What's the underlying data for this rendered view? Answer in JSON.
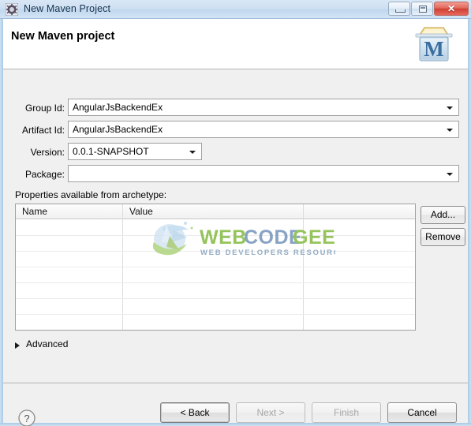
{
  "window": {
    "title": "New Maven Project",
    "icon": "maven-gear-icon",
    "controls": {
      "minimize": "minimize",
      "maximize": "maximize",
      "close": "✕"
    }
  },
  "header": {
    "title": "New Maven project",
    "logo_letter": "M",
    "logo_alt": "maven-box-icon"
  },
  "form": {
    "fields": [
      {
        "label": "Group Id:",
        "value": "AngularJsBackendEx",
        "type": "combo",
        "name": "group-id"
      },
      {
        "label": "Artifact Id:",
        "value": "AngularJsBackendEx",
        "type": "combo",
        "name": "artifact-id"
      },
      {
        "label": "Version:",
        "value": "0.0.1-SNAPSHOT",
        "type": "combo-short",
        "name": "version"
      },
      {
        "label": "Package:",
        "value": "",
        "type": "combo",
        "name": "package"
      }
    ]
  },
  "properties": {
    "section_label": "Properties available from archetype:",
    "columns": [
      "Name",
      "Value",
      ""
    ],
    "rows": [],
    "buttons": {
      "add": "Add...",
      "remove": "Remove"
    }
  },
  "advanced": {
    "label": "Advanced",
    "expanded": false,
    "icon": "triangle-right-icon"
  },
  "footer": {
    "help_icon": "?",
    "buttons": [
      {
        "label": "< Back",
        "enabled": true,
        "name": "back-button",
        "default": true
      },
      {
        "label": "Next >",
        "enabled": false,
        "name": "next-button",
        "default": false
      },
      {
        "label": "Finish",
        "enabled": false,
        "name": "finish-button",
        "default": false
      },
      {
        "label": "Cancel",
        "enabled": true,
        "name": "cancel-button",
        "default": false
      }
    ]
  },
  "watermark": {
    "line1_part1": "WEB",
    "line1_part2": "CODE",
    "line1_part3": "GEEKS",
    "line2": "WEB DEVELOPERS RESOURCE CENTER",
    "green": "#8cbf4e",
    "blue": "#7e9cc0"
  }
}
